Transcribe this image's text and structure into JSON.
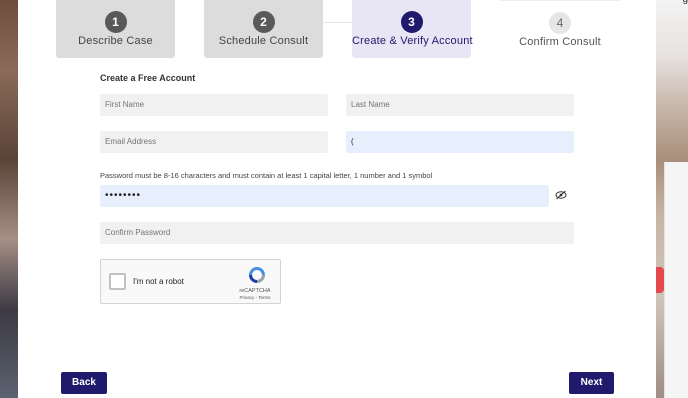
{
  "background": {
    "right_text": "g"
  },
  "steps": [
    {
      "number": "1",
      "label": "Describe Case",
      "state": "completed"
    },
    {
      "number": "2",
      "label": "Schedule Consult",
      "state": "completed"
    },
    {
      "number": "3",
      "label": "Create & Verify Account",
      "state": "active"
    },
    {
      "number": "4",
      "label": "Confirm Consult",
      "state": "upcoming"
    }
  ],
  "form": {
    "title": "Create a Free Account",
    "first_name": {
      "placeholder": "First Name",
      "value": ""
    },
    "last_name": {
      "placeholder": "Last Name",
      "value": ""
    },
    "email": {
      "placeholder": "Email Address",
      "value": ""
    },
    "phone": {
      "placeholder": "",
      "value": "("
    },
    "password_hint": "Password must be 8-16 characters and must contain at least 1 capital letter, 1 number and 1 symbol",
    "password": {
      "value": "••••••••"
    },
    "confirm_password": {
      "placeholder": "Confirm Password",
      "value": ""
    }
  },
  "captcha": {
    "label": "I'm not a robot",
    "brand": "reCAPTCHA",
    "terms": "Privacy - Terms"
  },
  "buttons": {
    "back": "Back",
    "next": "Next"
  },
  "colors": {
    "primary": "#1f1a6b",
    "active_step_bg": "#e8e6f5",
    "completed_step_bg": "#dcdcdc",
    "field_bg": "#f1f1f1",
    "active_field_bg": "#e8effc"
  }
}
